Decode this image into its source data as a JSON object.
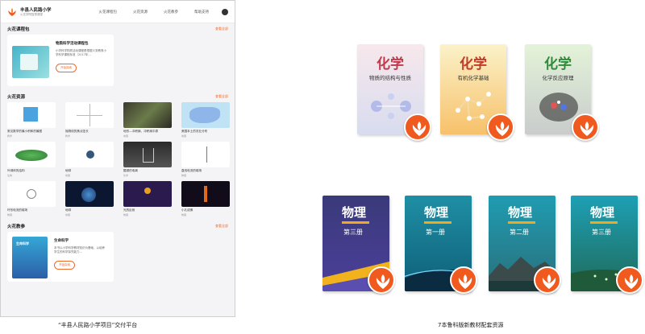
{
  "platform": {
    "school_name": "丰县人民路小学",
    "school_sub": "火花学院智慧课堂",
    "nav": [
      "火花课程包",
      "火花资源",
      "火花教参",
      "帮助支持"
    ],
    "sections": {
      "packages": {
        "title": "火花课程包",
        "see_all": "查看全部"
      },
      "resources": {
        "title": "火花资源",
        "see_all": "查看全部"
      },
      "references": {
        "title": "火花教参",
        "see_all": "查看全部"
      }
    },
    "package_card": {
      "title": "物质科学活动课程包",
      "desc": "小学科学物质活动课程是根据义务教育小学科学课程标准（2017年…",
      "button": "开始探索"
    },
    "resources": [
      {
        "title": "常见数学的最小积和的最图",
        "meta": "教学"
      },
      {
        "title": "抛物线的焦点弦长",
        "meta": "教学"
      },
      {
        "title": "地形—冲积扇、冲积扇平原",
        "meta": "地理"
      },
      {
        "title": "美国本土的农业分布",
        "meta": "地理"
      },
      {
        "title": "叶绿体的结构",
        "meta": "生物"
      },
      {
        "title": "地球",
        "meta": "地理"
      },
      {
        "title": "酸铜的电离",
        "meta": "化学"
      },
      {
        "title": "直线电流的磁场",
        "meta": "物理"
      },
      {
        "title": "环形电流的磁场",
        "meta": "物理"
      },
      {
        "title": "地球",
        "meta": "地理"
      },
      {
        "title": "光的反射",
        "meta": "物理"
      },
      {
        "title": "小孔成像",
        "meta": "物理"
      }
    ],
    "reference_card": {
      "title": "生命科学",
      "cover_text": "生命科学",
      "desc": "本书以小学科学教材知识为基础，以培养学生的科学探究能力…",
      "button": "开始探索"
    }
  },
  "captions": {
    "left": "“丰县人民路小学项目”交付平台",
    "right": "7本鲁科版新教材配套资源"
  },
  "chemistry_books": [
    {
      "title": "化学",
      "subtitle": "物质的结构与性质",
      "title_color": "#c13a4a",
      "bg_top": "#f7e8ec",
      "bg_bottom": "#d8dcef"
    },
    {
      "title": "化学",
      "subtitle": "有机化学基础",
      "title_color": "#c13a2a",
      "bg_top": "#fbf2c9",
      "bg_bottom": "#f7c16a"
    },
    {
      "title": "化学",
      "subtitle": "化学反应原理",
      "title_color": "#2f8a3a",
      "bg_top": "#e3f3d8",
      "bg_bottom": "#c9cccc"
    }
  ],
  "physics_books": [
    {
      "title": "物理",
      "subtitle": "第三册",
      "bg_top": "#3a3a7a",
      "bg_bottom": "#4b3f9a"
    },
    {
      "title": "物理",
      "subtitle": "第一册",
      "bg_top": "#1f8fa5",
      "bg_bottom": "#0e5f78"
    },
    {
      "title": "物理",
      "subtitle": "第二册",
      "bg_top": "#1f9cb2",
      "bg_bottom": "#2a6f7a"
    },
    {
      "title": "物理",
      "subtitle": "第三册",
      "bg_top": "#1ea0b5",
      "bg_bottom": "#1f6a5a"
    }
  ],
  "colors": {
    "accent": "#f05a1e",
    "link": "#f06a2a"
  },
  "icons": [
    "spark-logo-icon",
    "user-avatar-icon"
  ]
}
